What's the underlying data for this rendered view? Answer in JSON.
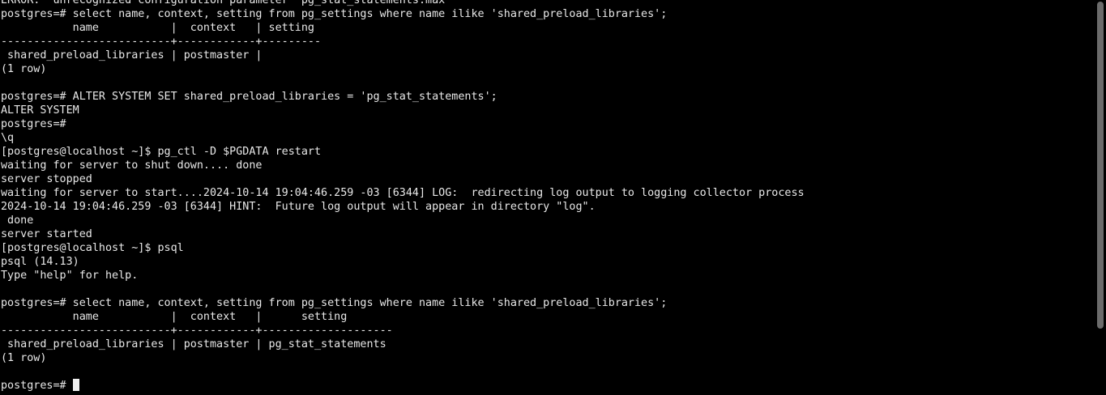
{
  "terminal": {
    "lines": [
      "ERROR:  unrecognized configuration parameter \"pg_stat_statements.max\"",
      "postgres=# select name, context, setting from pg_settings where name ilike 'shared_preload_libraries';",
      "           name           |  context   | setting",
      "--------------------------+------------+---------",
      " shared_preload_libraries | postmaster |",
      "(1 row)",
      "",
      "postgres=# ALTER SYSTEM SET shared_preload_libraries = 'pg_stat_statements';",
      "ALTER SYSTEM",
      "postgres=#",
      "\\q",
      "[postgres@localhost ~]$ pg_ctl -D $PGDATA restart",
      "waiting for server to shut down.... done",
      "server stopped",
      "waiting for server to start....2024-10-14 19:04:46.259 -03 [6344] LOG:  redirecting log output to logging collector process",
      "2024-10-14 19:04:46.259 -03 [6344] HINT:  Future log output will appear in directory \"log\".",
      " done",
      "server started",
      "[postgres@localhost ~]$ psql",
      "psql (14.13)",
      "Type \"help\" for help.",
      "",
      "postgres=# select name, context, setting from pg_settings where name ilike 'shared_preload_libraries';",
      "           name           |  context   |      setting",
      "--------------------------+------------+--------------------",
      " shared_preload_libraries | postmaster | pg_stat_statements",
      "(1 row)",
      ""
    ],
    "prompt": "postgres=# "
  }
}
